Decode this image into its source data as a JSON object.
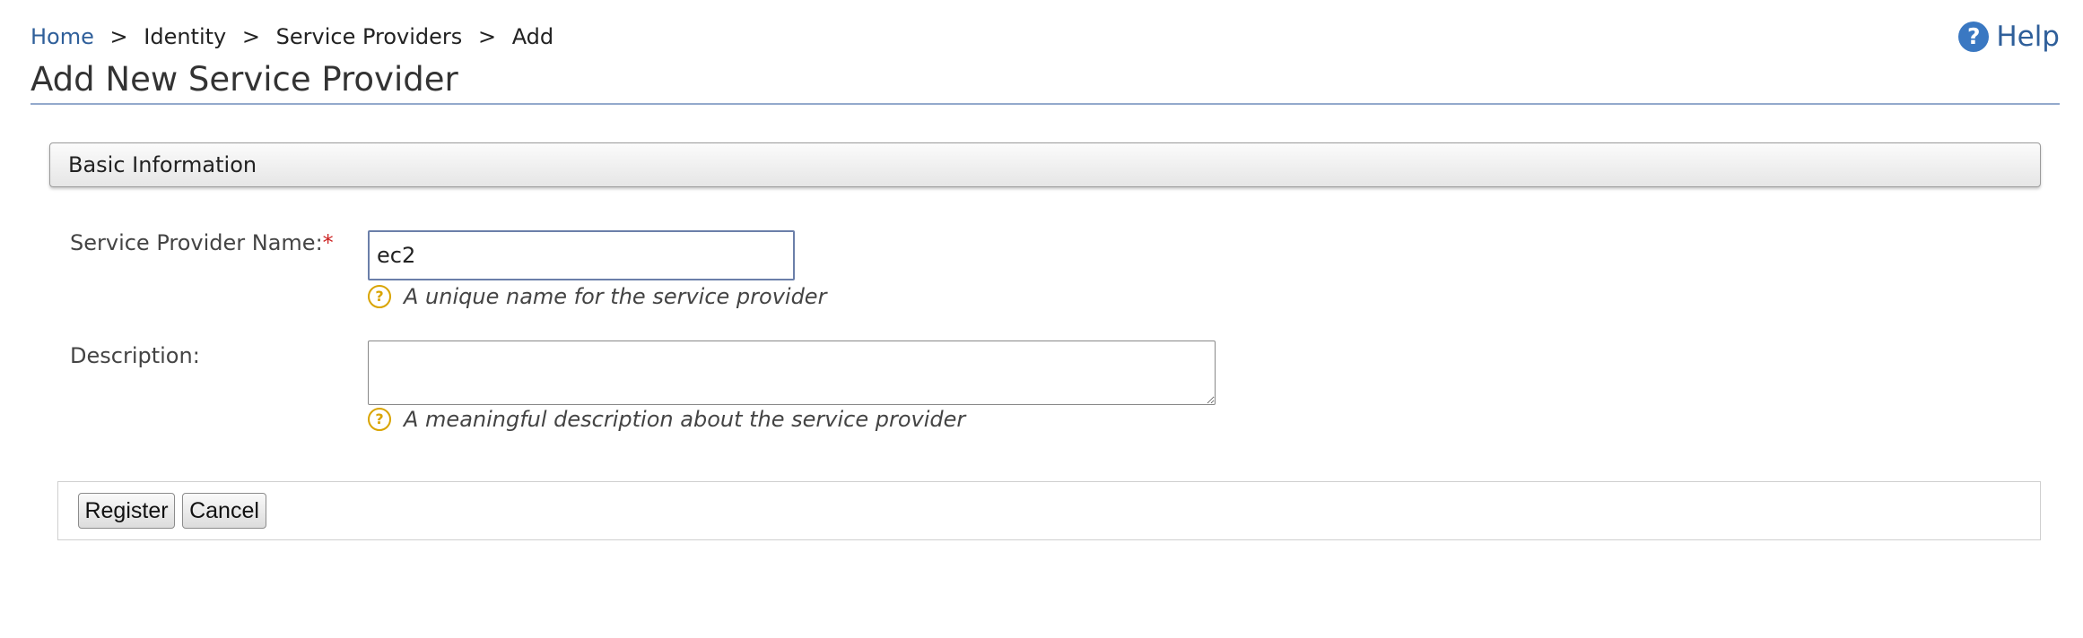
{
  "breadcrumb": {
    "items": [
      "Home",
      "Identity",
      "Service Providers",
      "Add"
    ],
    "separator": ">"
  },
  "help": {
    "icon": "?",
    "label": "Help"
  },
  "page": {
    "title": "Add New Service Provider"
  },
  "section": {
    "title": "Basic Information"
  },
  "form": {
    "name": {
      "label": "Service Provider Name:",
      "required_mark": "*",
      "value": "ec2",
      "hint": "A unique name for the service provider"
    },
    "description": {
      "label": "Description:",
      "value": "",
      "hint": "A meaningful description about the service provider"
    },
    "hint_icon": "?"
  },
  "buttons": {
    "register": "Register",
    "cancel": "Cancel"
  },
  "colors": {
    "link": "#2f5f9a",
    "help_icon": "#3a78c2",
    "required": "#cc2222",
    "hint_icon": "#d9a400",
    "title_rule": "#93a9cc"
  }
}
